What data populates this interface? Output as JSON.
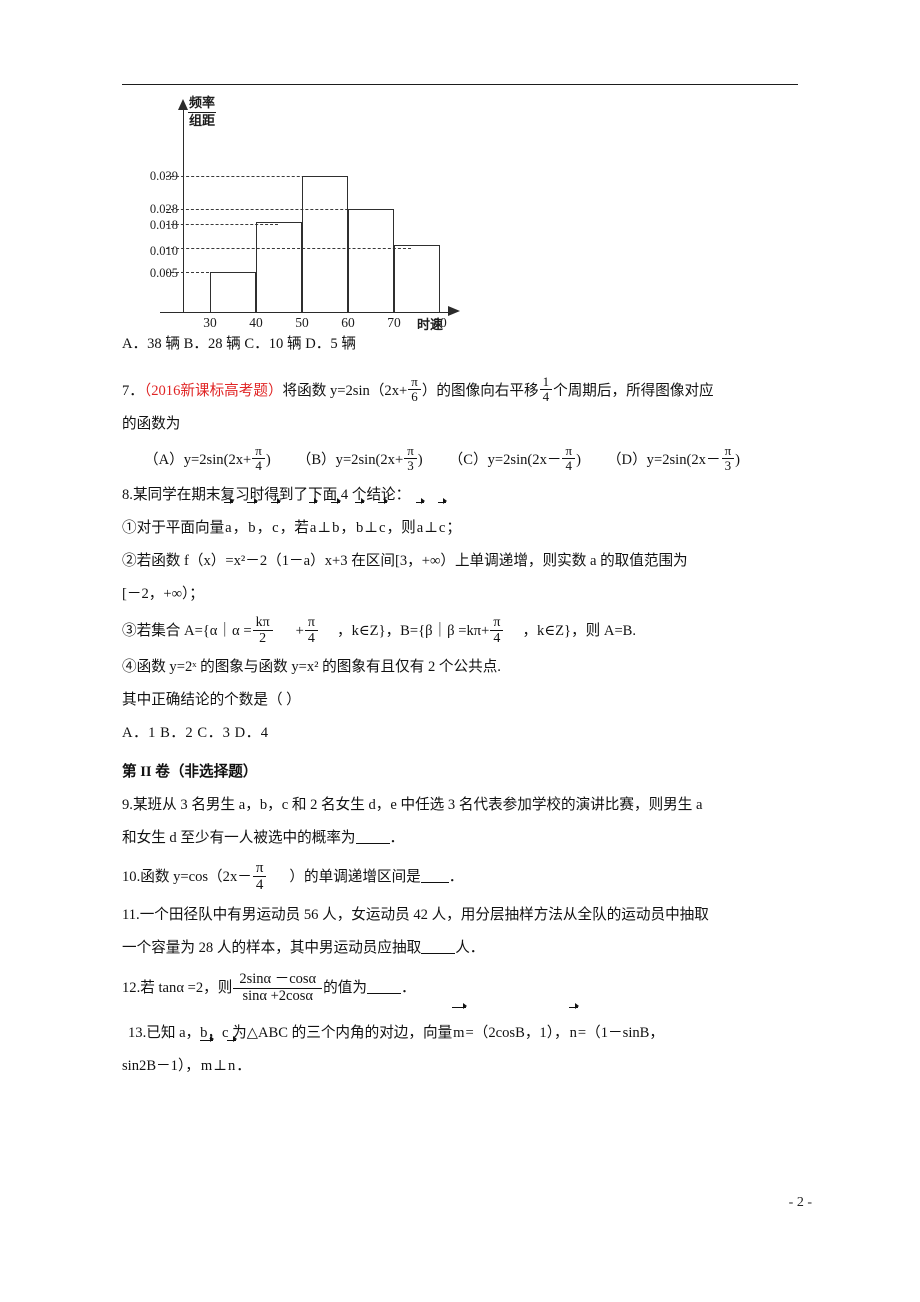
{
  "document": {
    "page_number": "- 2 -",
    "accent_red": "#e02424"
  },
  "chart_data": {
    "type": "bar",
    "title": "",
    "ylabel_numerator": "频率",
    "ylabel_denominator": "组距",
    "xlabel": "时速",
    "categories": [
      "30-40",
      "40-50",
      "50-60",
      "60-70",
      "70-80"
    ],
    "bin_edges": [
      30,
      40,
      50,
      60,
      70,
      80
    ],
    "values": [
      0.005,
      0.02,
      0.039,
      0.028,
      0.012
    ],
    "ytick_labels": [
      "0.039",
      "0.028",
      "0.018",
      "0.010",
      "0.005"
    ],
    "ytick_values": [
      0.039,
      0.028,
      0.018,
      0.01,
      0.005
    ],
    "xtick_labels": [
      "30",
      "40",
      "50",
      "60",
      "70",
      "80"
    ],
    "grid": "dashed-horizontal",
    "legend": "none",
    "ylim": [
      0,
      0.046
    ],
    "xlim": [
      25,
      85
    ]
  },
  "questions": {
    "q6_options": "A．38 辆 B．28 辆 C．10 辆 D．5 辆",
    "q7": {
      "number": "7．",
      "tag": "（2016新课标高考题）",
      "stem_a": "将函数 y=2sin（2x+",
      "stem_frac_n": "π",
      "stem_frac_d": "6",
      "stem_b": "）的图像向右平移",
      "shift_n": "1",
      "shift_d": "4",
      "stem_c": "个周期后，所得图像对应",
      "line2": "的函数为",
      "options": [
        {
          "label": "（A）",
          "expr_a": "y=2sin(2x+",
          "fn": "π",
          "fd": "4",
          "expr_b": ")"
        },
        {
          "label": "（B）",
          "expr_a": "y=2sin(2x+",
          "fn": "π",
          "fd": "3",
          "expr_b": ")"
        },
        {
          "label": "（C）",
          "expr_a": "y=2sin(2x－",
          "fn": "π",
          "fd": "4",
          "expr_b": ")"
        },
        {
          "label": "（D）",
          "expr_a": "y=2sin(2x－",
          "fn": "π",
          "fd": "3",
          "expr_b": ")"
        }
      ]
    },
    "q8": {
      "stem": "8.某同学在期末复习时得到了下面 4 个结论：",
      "item1_a": "①对于平面向量",
      "item1_v1": "a",
      "item1_s1": "，",
      "item1_v2": "b",
      "item1_s2": "，",
      "item1_v3": "c",
      "item1_s3": "，若",
      "item1_v4": "a",
      "item1_s4": "⊥",
      "item1_v5": "b",
      "item1_s5": "，",
      "item1_v6": "b",
      "item1_s6": "⊥",
      "item1_v7": "c",
      "item1_s7": "，则",
      "item1_v8": "a",
      "item1_s8": "⊥",
      "item1_v9": "c",
      "item1_s9": "；",
      "item2_line1": "②若函数 f（x）=x²－2（1－a）x+3 在区间[3，+∞）上单调递增，则实数 a 的取值范围为",
      "item2_line2": "[－2，+∞）；",
      "item3_a": "③若集合 A={α｜α =",
      "item3_f1n": "kπ",
      "item3_f1d": "2",
      "item3_b": "+",
      "item3_f2n": "π",
      "item3_f2d": "4",
      "item3_c": "，k∈Z}，B={β｜β =kπ+",
      "item3_f3n": "π",
      "item3_f3d": "4",
      "item3_d": "，k∈Z}，则 A=B.",
      "item4": "④函数 y=2ˣ 的图象与函数 y=x² 的图象有且仅有 2 个公共点.",
      "prompt": "其中正确结论的个数是（      ）",
      "options": "A．1      B．2      C．3      D．4"
    },
    "section2_title": "第 II 卷（非选择题）",
    "q9": {
      "line1": "9.某班从 3 名男生 a，b，c 和 2 名女生 d，e 中任选 3 名代表参加学校的演讲比赛，则男生 a",
      "line2_a": "和女生 d 至少有一人被选中的概率为",
      "line2_b": "．"
    },
    "q10": {
      "a": "10.函数 y=cos（2x－",
      "fn": "π",
      "fd": "4",
      "b": "）的单调递增区间是",
      "c": "．"
    },
    "q11": {
      "line1": "11.一个田径队中有男运动员 56 人，女运动员 42 人，用分层抽样方法从全队的运动员中抽取",
      "line2_a": "一个容量为 28 人的样本，其中男运动员应抽取",
      "line2_b": "人．"
    },
    "q12": {
      "a": "12.若 tanα =2，则",
      "fn": "2sinα －cosα",
      "fd": "sinα +2cosα",
      "b": "的值为",
      "c": "．"
    },
    "q13": {
      "line1_a": "13.已知 a，b，c 为△ABC 的三个内角的对边，向量",
      "line1_v1": "m",
      "line1_b": "=（2cosB，1），",
      "line1_v2": "n",
      "line1_c": "=（1－sinB，",
      "line2_a": "sin2B－1），",
      "line2_v1": "m",
      "line2_b": "⊥",
      "line2_v2": "n",
      "line2_c": "．"
    }
  }
}
